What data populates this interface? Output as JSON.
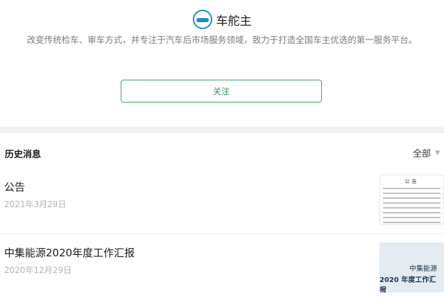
{
  "account": {
    "name": "车舵主",
    "logo_icon": "car-logo-icon",
    "description": "改变传统检车、审车方式，并专注于汽车后市场服务领域，致力于打造全国车主优选的第一服务平台。",
    "follow_label": "关注"
  },
  "history": {
    "title": "历史消息",
    "filter_label": "全部",
    "filter_icon": "chevron-down-icon",
    "articles": [
      {
        "title": "公告",
        "date": "2021年3月29日",
        "thumb_heading": "公告"
      },
      {
        "title": "中集能源2020年度工作汇报",
        "date": "2020年12月29日",
        "thumb_line1": "中集能源",
        "thumb_line2": "2020 年度工作汇报"
      }
    ]
  },
  "colors": {
    "accent_green": "#37a862",
    "logo_blue": "#1f8fb5",
    "date_gray": "#b3b3b3",
    "separator": "#f0f0f0"
  }
}
